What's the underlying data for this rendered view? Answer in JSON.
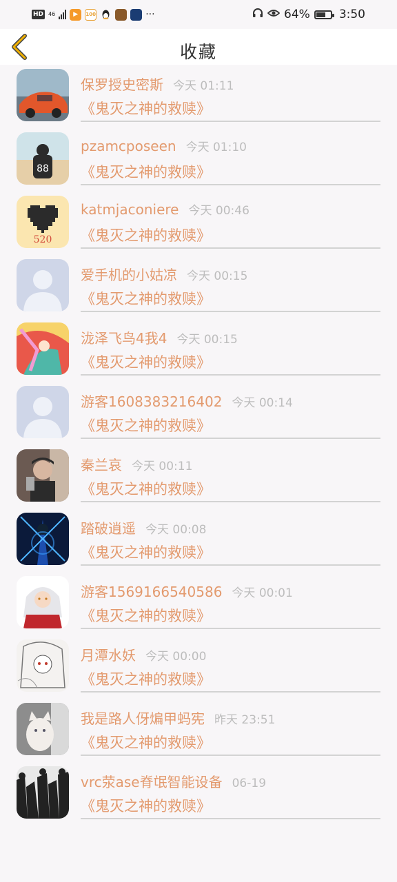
{
  "status_bar": {
    "network": "HD",
    "signal": "46",
    "battery_percent": "64%",
    "battery_level": 0.64,
    "time": "3:50",
    "app_icons": [
      "video-app-icon",
      "100-app-icon",
      "qq-icon",
      "game-app-icon",
      "browser-app-icon"
    ],
    "more": "···"
  },
  "header": {
    "title": "收藏",
    "accent_color": "#f0b000"
  },
  "favorites": [
    {
      "user": "保罗授史密斯",
      "time": "今天 01:11",
      "book": "《鬼灭之神的救赎》",
      "avatar": "car-photo"
    },
    {
      "user": "pzamcposeen",
      "time": "今天 01:10",
      "book": "《鬼灭之神的救赎》",
      "avatar": "beach-88-photo"
    },
    {
      "user": "katmjaconiere",
      "time": "今天 00:46",
      "book": "《鬼灭之神的救赎》",
      "avatar": "pixel-heart-520"
    },
    {
      "user": "爱手机的小姑凉",
      "time": "今天 00:15",
      "book": "《鬼灭之神的救赎》",
      "avatar": "default-avatar"
    },
    {
      "user": "泷泽飞鸟4我4",
      "time": "今天 00:15",
      "book": "《鬼灭之神的救赎》",
      "avatar": "anime-colorful"
    },
    {
      "user": "游客1608383216402",
      "time": "今天 00:14",
      "book": "《鬼灭之神的救赎》",
      "avatar": "default-avatar"
    },
    {
      "user": "秦兰哀",
      "time": "今天 00:11",
      "book": "《鬼灭之神的救赎》",
      "avatar": "selfie-photo"
    },
    {
      "user": "踏破逍遥",
      "time": "今天 00:08",
      "book": "《鬼灭之神的救赎》",
      "avatar": "blue-swordsman"
    },
    {
      "user": "游客1569166540586",
      "time": "今天 00:01",
      "book": "《鬼灭之神的救赎》",
      "avatar": "inuyasha"
    },
    {
      "user": "月潭水妖",
      "time": "今天 00:00",
      "book": "《鬼灭之神的救赎》",
      "avatar": "sketch-girl"
    },
    {
      "user": "我是路人伢煸甲蚂宪",
      "time": "昨天 23:51",
      "book": "《鬼灭之神的救赎》",
      "avatar": "white-cat"
    },
    {
      "user": "vrc荥ase脊氓智能设备",
      "time": "06-19",
      "book": "《鬼灭之神的救赎》",
      "avatar": "bw-crowd"
    }
  ]
}
